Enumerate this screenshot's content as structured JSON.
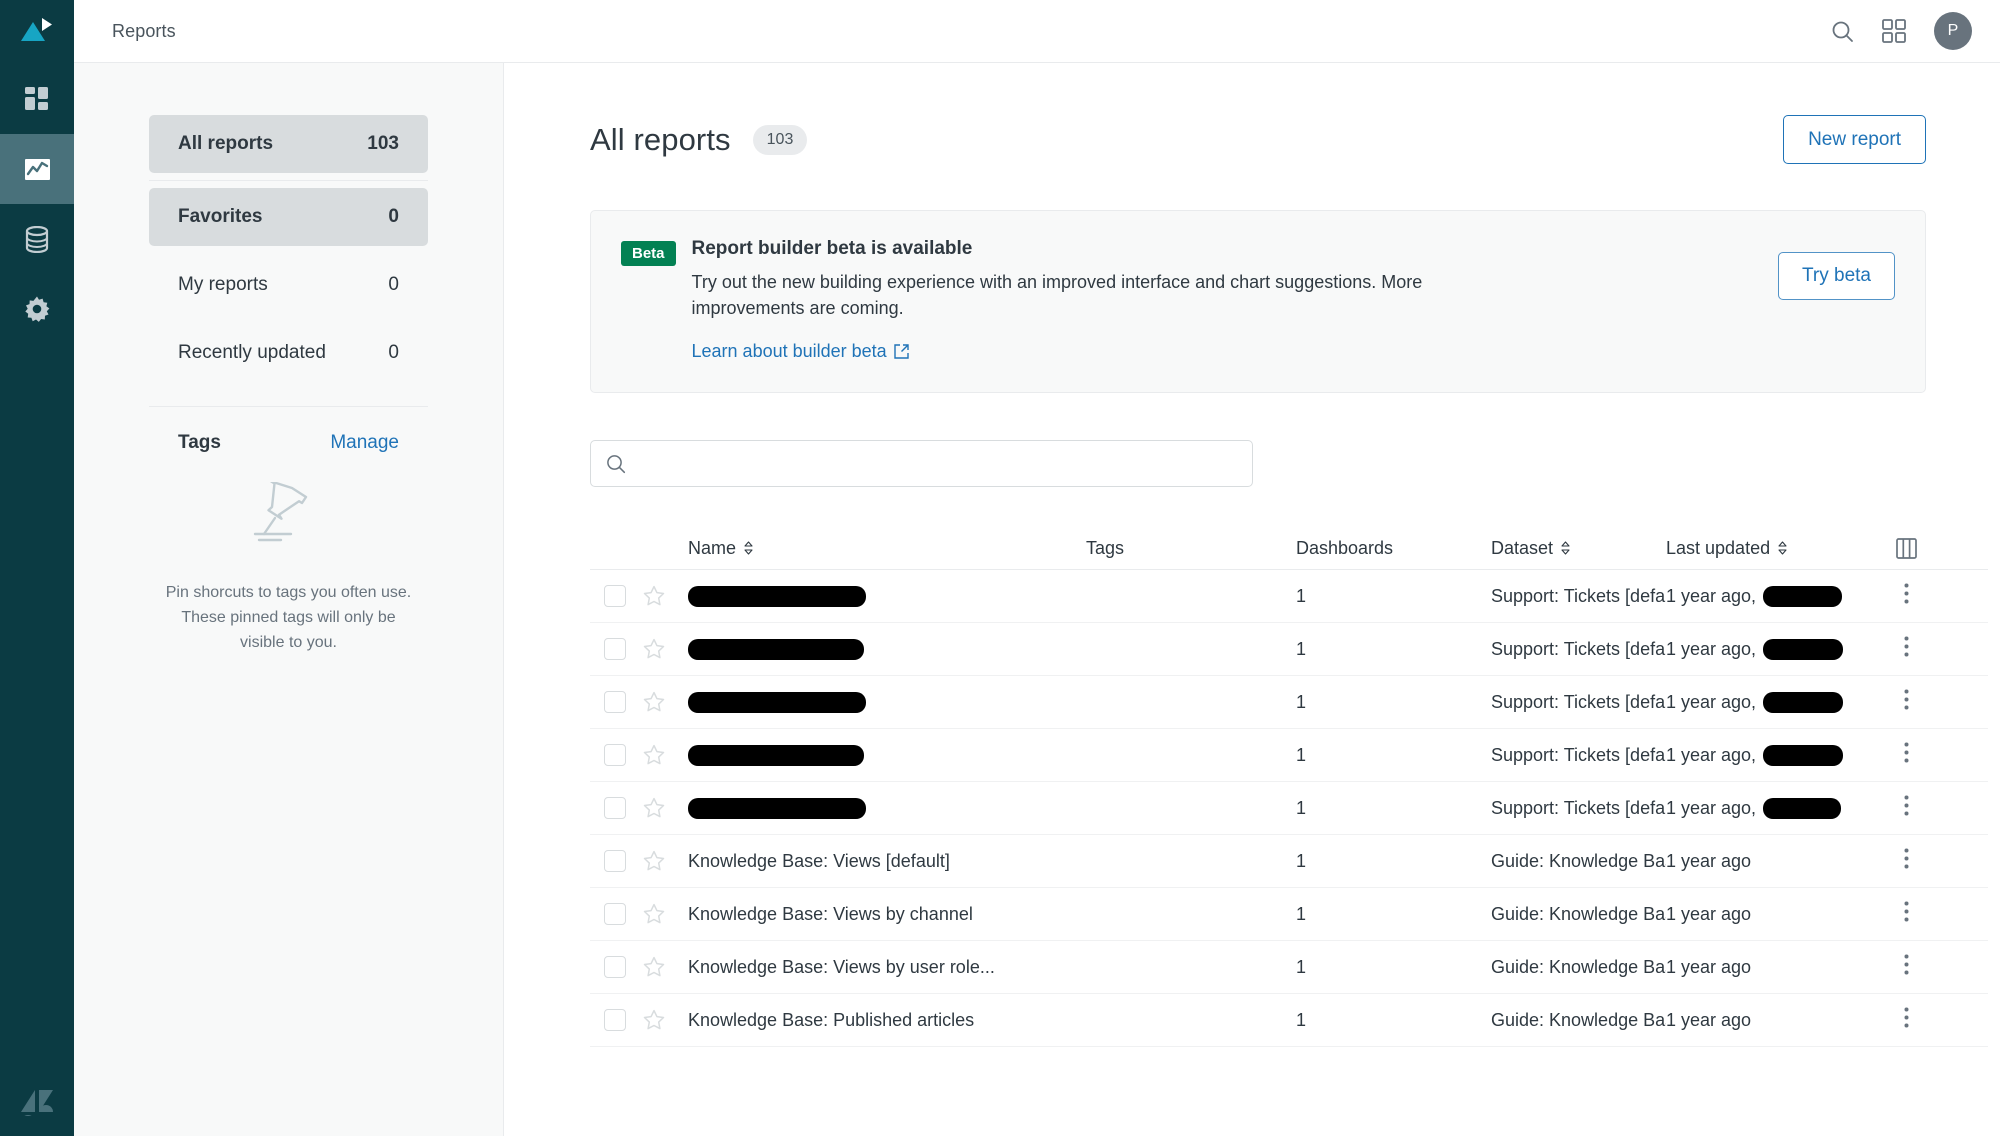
{
  "rail": {
    "logo_icon": "zendesk-explore-logo",
    "items": [
      {
        "icon": "dashboards-grid-icon",
        "name": "dashboards",
        "active": false
      },
      {
        "icon": "reports-chart-icon",
        "name": "reports",
        "active": true
      },
      {
        "icon": "datasets-database-icon",
        "name": "datasets",
        "active": false
      },
      {
        "icon": "settings-gear-icon",
        "name": "settings",
        "active": false
      }
    ],
    "bottom_logo_icon": "zendesk-logo"
  },
  "topbar": {
    "title": "Reports",
    "search_icon": "search-icon",
    "apps_icon": "apps-grid-icon",
    "avatar_initial": "P"
  },
  "sidebar": {
    "items": [
      {
        "label": "All reports",
        "count": "103",
        "selected": true
      },
      {
        "label": "Favorites",
        "count": "0",
        "selected": true
      },
      {
        "label": "My reports",
        "count": "0",
        "selected": false
      },
      {
        "label": "Recently updated",
        "count": "0",
        "selected": false
      }
    ],
    "tags": {
      "title": "Tags",
      "manage_label": "Manage",
      "empty_icon": "pin-icon",
      "empty_text": "Pin shorcuts to tags you often use. These pinned tags will only be visible to you."
    }
  },
  "main": {
    "title": "All reports",
    "count": "103",
    "new_report_label": "New report",
    "banner": {
      "tag": "Beta",
      "title": "Report builder beta is available",
      "description": "Try out the new building experience with an improved interface and chart suggestions. More improvements are coming.",
      "link_label": "Learn about builder beta",
      "link_icon": "external-link-icon",
      "action_label": "Try beta"
    },
    "search": {
      "icon": "search-icon",
      "value": "",
      "placeholder": ""
    },
    "table": {
      "columns_icon": "columns-settings-icon",
      "headers": {
        "name": "Name",
        "tags": "Tags",
        "dashboards": "Dashboards",
        "dataset": "Dataset",
        "last_updated": "Last updated"
      },
      "sortable": [
        "name",
        "dataset",
        "last_updated"
      ],
      "rows": [
        {
          "name": "",
          "name_redacted": true,
          "name_redact_width": 178,
          "tags": "",
          "dashboards": "1",
          "dataset": "Support: Tickets [defau",
          "last_updated": "1 year ago,",
          "updated_redacted": true,
          "updated_redact_width": 79
        },
        {
          "name": "",
          "name_redacted": true,
          "name_redact_width": 176,
          "tags": "",
          "dashboards": "1",
          "dataset": "Support: Tickets [defau",
          "last_updated": "1 year ago,",
          "updated_redacted": true,
          "updated_redact_width": 80
        },
        {
          "name": "",
          "name_redacted": true,
          "name_redact_width": 178,
          "tags": "",
          "dashboards": "1",
          "dataset": "Support: Tickets [defau",
          "last_updated": "1 year ago,",
          "updated_redacted": true,
          "updated_redact_width": 80
        },
        {
          "name": "",
          "name_redacted": true,
          "name_redact_width": 176,
          "tags": "",
          "dashboards": "1",
          "dataset": "Support: Tickets [defau",
          "last_updated": "1 year ago,",
          "updated_redacted": true,
          "updated_redact_width": 80
        },
        {
          "name": "",
          "name_redacted": true,
          "name_redact_width": 178,
          "tags": "",
          "dashboards": "1",
          "dataset": "Support: Tickets [defau",
          "last_updated": "1 year ago,",
          "updated_redacted": true,
          "updated_redact_width": 78
        },
        {
          "name": "Knowledge Base: Views [default]",
          "name_redacted": false,
          "tags": "",
          "dashboards": "1",
          "dataset": "Guide: Knowledge Base",
          "last_updated": "1 year ago",
          "updated_redacted": false
        },
        {
          "name": "Knowledge Base: Views by channel",
          "name_redacted": false,
          "tags": "",
          "dashboards": "1",
          "dataset": "Guide: Knowledge Base",
          "last_updated": "1 year ago",
          "updated_redacted": false
        },
        {
          "name": "Knowledge Base: Views by user role...",
          "name_redacted": false,
          "tags": "",
          "dashboards": "1",
          "dataset": "Guide: Knowledge Base",
          "last_updated": "1 year ago",
          "updated_redacted": false
        },
        {
          "name": "Knowledge Base: Published articles",
          "name_redacted": false,
          "tags": "",
          "dashboards": "1",
          "dataset": "Guide: Knowledge Base",
          "last_updated": "1 year ago",
          "updated_redacted": false
        }
      ]
    }
  },
  "colors": {
    "rail_bg": "#0B3B43",
    "rail_active": "#49717B",
    "logo_accent": "#17A5C4",
    "link": "#1f73b7",
    "beta_green": "#038153",
    "sidebar_bg": "#f8f9f9",
    "selected_bg": "#d8dcde",
    "text": "#2f3941",
    "muted": "#68737d"
  }
}
